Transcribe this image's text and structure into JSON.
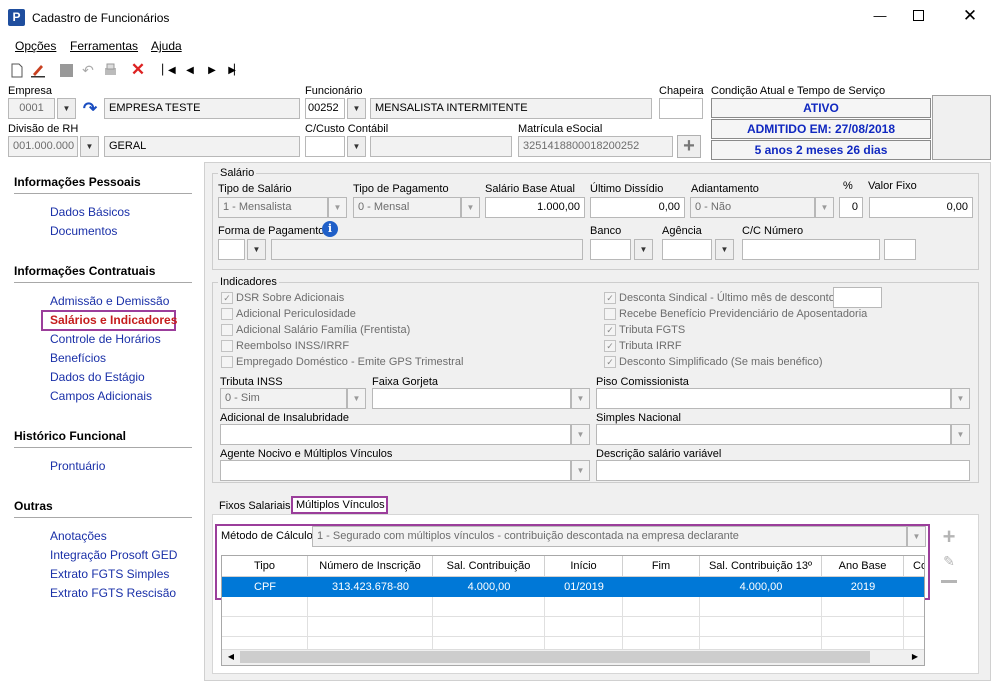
{
  "window": {
    "title": "Cadastro de Funcionários"
  },
  "menu": {
    "opcoes": "Opções",
    "ferramentas": "Ferramentas",
    "ajuda": "Ajuda"
  },
  "header": {
    "empresa_label": "Empresa",
    "empresa_code": "0001",
    "empresa_name": "EMPRESA TESTE",
    "funcionario_label": "Funcionário",
    "funcionario_code": "00252",
    "funcionario_name": "MENSALISTA INTERMITENTE",
    "chapeira_label": "Chapeira",
    "condicao_label": "Condição Atual e Tempo de Serviço",
    "status_ativo": "ATIVO",
    "status_admitido": "ADMITIDO EM: 27/08/2018",
    "status_tempo": "5 anos 2 meses 26 dias",
    "divisao_label": "Divisão de RH",
    "divisao_code": "001.000.000",
    "divisao_name": "GERAL",
    "ccusto_label": "C/Custo Contábil",
    "matricula_label": "Matrícula eSocial",
    "matricula_value": "3251418800018200252"
  },
  "sidebar": {
    "sec_pessoais": "Informações Pessoais",
    "dados_basicos": "Dados Básicos",
    "documentos": "Documentos",
    "sec_contratuais": "Informações Contratuais",
    "admissao": "Admissão e Demissão",
    "salarios": "Salários e Indicadores",
    "horarios": "Controle de Horários",
    "beneficios": "Benefícios",
    "estagio": "Dados do Estágio",
    "campos": "Campos Adicionais",
    "sec_historico": "Histórico Funcional",
    "prontuario": "Prontuário",
    "sec_outras": "Outras",
    "anotacoes": "Anotações",
    "integracao": "Integração Prosoft GED",
    "extrato_simples": "Extrato FGTS Simples",
    "extrato_rescisao": "Extrato FGTS Rescisão"
  },
  "salario": {
    "group": "Salário",
    "tipo_label": "Tipo de Salário",
    "tipo_value": "1 - Mensalista",
    "tipo_pag_label": "Tipo de Pagamento",
    "tipo_pag_value": "0 - Mensal",
    "base_label": "Salário Base Atual",
    "base_value": "1.000,00",
    "dissidio_label": "Último Dissídio",
    "dissidio_value": "0,00",
    "adiant_label": "Adiantamento",
    "adiant_value": "0 - Não",
    "pct_label": "%",
    "pct_value": "0",
    "valor_fixo_label": "Valor Fixo",
    "valor_fixo_value": "0,00",
    "forma_label": "Forma de Pagamento",
    "banco_label": "Banco",
    "agencia_label": "Agência",
    "cc_label": "C/C Número"
  },
  "indicadores": {
    "group": "Indicadores",
    "left": [
      {
        "label": "DSR Sobre Adicionais",
        "checked": true
      },
      {
        "label": "Adicional Periculosidade",
        "checked": false
      },
      {
        "label": "Adicional Salário Família (Frentista)",
        "checked": false
      },
      {
        "label": "Reembolso INSS/IRRF",
        "checked": false
      },
      {
        "label": "Empregado Doméstico - Emite GPS Trimestral",
        "checked": false
      }
    ],
    "right": [
      {
        "label": "Desconta Sindical - Último mês de desconto",
        "checked": true
      },
      {
        "label": "Recebe Benefício Previdenciário de Aposentadoria",
        "checked": false
      },
      {
        "label": "Tributa FGTS",
        "checked": true
      },
      {
        "label": "Tributa IRRF",
        "checked": true
      },
      {
        "label": "Desconto Simplificado (Se mais benéfico)",
        "checked": true
      }
    ],
    "tributa_inss_label": "Tributa INSS",
    "tributa_inss_value": "0 - Sim",
    "faixa_label": "Faixa Gorjeta",
    "piso_label": "Piso Comissionista",
    "insalubridade_label": "Adicional de Insalubridade",
    "simples_label": "Simples Nacional",
    "agente_label": "Agente Nocivo e  Múltiplos Vínculos",
    "descricao_label": "Descrição salário variável"
  },
  "tabs": {
    "fixos": "Fixos Salariais",
    "multiplos": "Múltiplos Vínculos"
  },
  "multiplos": {
    "metodo_label": "Método de Cálculo",
    "metodo_value": "1 - Segurado com múltiplos vínculos - contribuição descontada na empresa declarante",
    "columns": [
      "Tipo",
      "Número de Inscrição",
      "Sal. Contribuição",
      "Início",
      "Fim",
      "Sal. Contribuição 13º",
      "Ano Base",
      "Co"
    ],
    "row": [
      "CPF",
      "313.423.678-80",
      "4.000,00",
      "01/2019",
      "",
      "4.000,00",
      "2019",
      ""
    ]
  },
  "colors": {
    "highlight": "#9b3e9b",
    "selection": "#0078d7",
    "link": "#1a30a8",
    "status": "#1028c0"
  }
}
